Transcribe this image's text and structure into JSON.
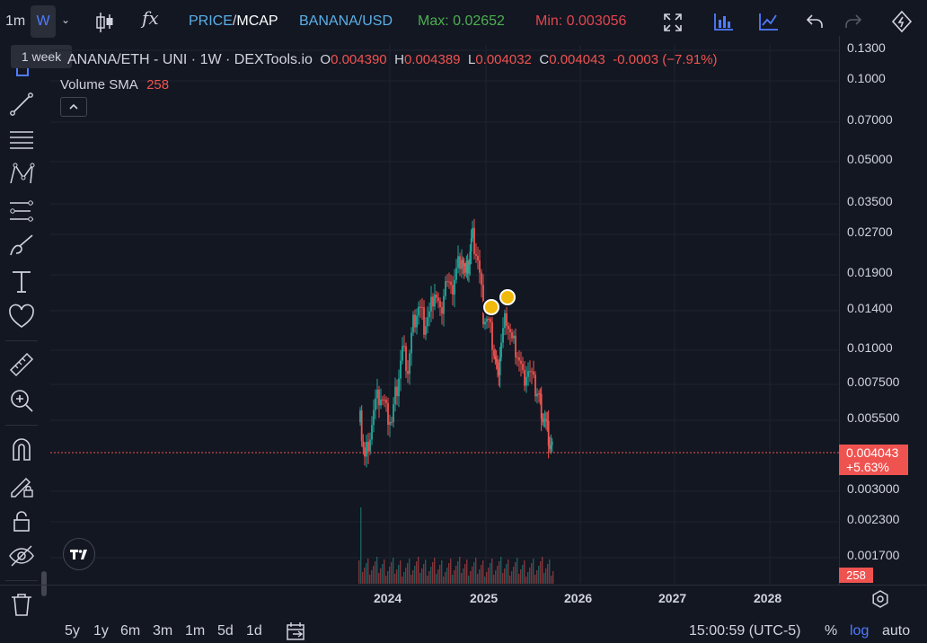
{
  "toolbar": {
    "timeframe_1m": "1m",
    "timeframe_active": "W",
    "tooltip": "1 week",
    "fx_label": "fx",
    "price_label": "PRICE",
    "separator": "/",
    "mcap_label": "MCAP",
    "pair": "BANANA/USD",
    "max_label": "Max: 0.02652",
    "min_label": "Min: 0.003056",
    "colors": {
      "accent": "#3b82f6",
      "pair": "#5ab0e8",
      "max": "#4caf50",
      "min": "#e0464e"
    }
  },
  "legend": {
    "symbol": "ANANA/ETH - UNI · 1W · DEXTools.io",
    "o_label": "O",
    "o_value": "0.004390",
    "h_label": "H",
    "h_value": "0.004389",
    "l_label": "L",
    "l_value": "0.004032",
    "c_label": "C",
    "c_value": "0.004043",
    "change": "-0.0003 (−7.91%)",
    "volume_label": "Volume SMA",
    "volume_value": "258"
  },
  "price_axis": {
    "ticks": [
      "0.1300",
      "0.1000",
      "0.07000",
      "0.05000",
      "0.03500",
      "0.02700",
      "0.01900",
      "0.01400",
      "0.01000",
      "0.007500",
      "0.005500",
      "0.003000",
      "0.002300",
      "0.001700"
    ],
    "current_price": "0.004043",
    "current_change": "+5.63%",
    "volume_badge": "258"
  },
  "time_axis": {
    "ticks": [
      "2024",
      "2025",
      "2026",
      "2027",
      "2028"
    ]
  },
  "bottom": {
    "ranges": [
      "5y",
      "1y",
      "6m",
      "3m",
      "1m",
      "5d",
      "1d"
    ],
    "clock": "15:00:59 (UTC-5)",
    "percent": "%",
    "log": "log",
    "auto": "auto"
  },
  "chart_data": {
    "type": "candlestick",
    "title": "ANANA/ETH - UNI · 1W · DEXTools.io",
    "scale": "log",
    "ylim": [
      0.0015,
      0.13
    ],
    "x_ticks": [
      "2024",
      "2025",
      "2026",
      "2027",
      "2028"
    ],
    "last_close": 0.004043,
    "max": 0.02652,
    "min": 0.003056,
    "grid": true,
    "colors": {
      "up": "#26a69a",
      "down": "#ef5350"
    }
  }
}
